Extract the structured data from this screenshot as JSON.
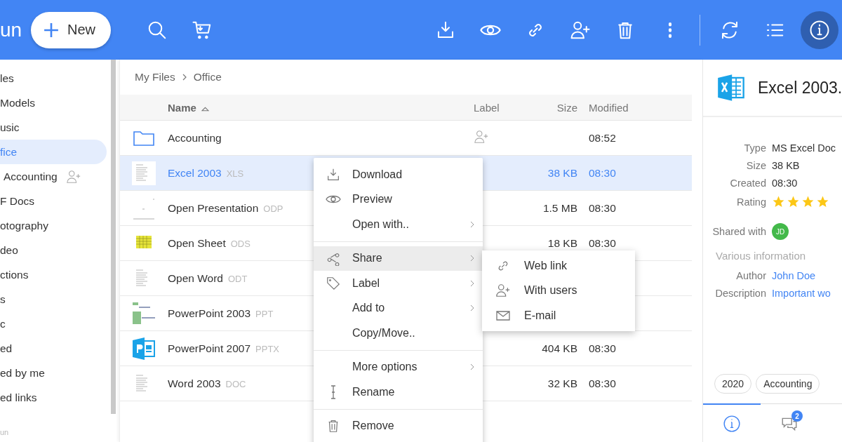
{
  "header": {
    "logo_text": "un",
    "new_button": "New",
    "toolbar_left": [
      {
        "kind": "download",
        "selected": false
      },
      {
        "kind": "preview",
        "selected": false
      },
      {
        "kind": "link",
        "selected": false
      },
      {
        "kind": "share-user",
        "selected": false
      },
      {
        "kind": "trash",
        "selected": false
      },
      {
        "kind": "more",
        "selected": false
      }
    ],
    "toolbar_right": [
      {
        "kind": "refresh",
        "selected": false
      },
      {
        "kind": "list",
        "selected": false
      },
      {
        "kind": "info",
        "selected": true
      }
    ]
  },
  "sidebar": {
    "items": [
      {
        "label": "les",
        "selected": false,
        "shared": false
      },
      {
        "label": "Models",
        "selected": false,
        "shared": false
      },
      {
        "label": "usic",
        "selected": false,
        "shared": false
      },
      {
        "label": "fice",
        "selected": true,
        "shared": false,
        "children": [
          {
            "label": "Accounting",
            "selected": false,
            "shared": true
          }
        ]
      },
      {
        "label": "F Docs",
        "selected": false,
        "shared": false
      },
      {
        "label": "otography",
        "selected": false,
        "shared": false
      },
      {
        "label": "deo",
        "selected": false,
        "shared": false
      },
      {
        "label": "ctions",
        "selected": false,
        "shared": false
      },
      {
        "label": "s",
        "selected": false,
        "shared": false
      },
      {
        "label": "c",
        "selected": false,
        "shared": false
      },
      {
        "label": "ed",
        "selected": false,
        "shared": false
      },
      {
        "label": "ed by me",
        "selected": false,
        "shared": false
      },
      {
        "label": "ed links",
        "selected": false,
        "shared": false
      }
    ],
    "footer": "un"
  },
  "breadcrumb": [
    "My Files",
    "Office"
  ],
  "table": {
    "columns": [
      {
        "label": "Name",
        "sorted": true
      },
      {
        "label": "Label",
        "sorted": false
      },
      {
        "label": "Size",
        "sorted": false
      },
      {
        "label": "Modified",
        "sorted": false
      }
    ],
    "rows": [
      {
        "kind": "folder",
        "name": "Accounting",
        "shared": true,
        "modified": "08:52",
        "selected": false
      },
      {
        "kind": "sheet-doc",
        "name": "Excel 2003",
        "ext": "XLS",
        "size": "38 KB",
        "modified": "08:30",
        "selected": true
      },
      {
        "kind": "slide-doc",
        "name": "Open Presentation",
        "ext": "ODP",
        "size": "1.5 MB",
        "modified": "08:30",
        "selected": false
      },
      {
        "kind": "yellow-sheet",
        "name": "Open Sheet",
        "ext": "ODS",
        "size": "18 KB",
        "modified": "08:30",
        "selected": false
      },
      {
        "kind": "text-doc",
        "name": "Open Word",
        "ext": "ODT",
        "selected": false
      },
      {
        "kind": "green-slide",
        "name": "PowerPoint 2003",
        "ext": "PPT",
        "selected": false
      },
      {
        "kind": "pptx",
        "name": "PowerPoint 2007",
        "ext": "PPTX",
        "size": "404 KB",
        "modified": "08:30",
        "selected": false
      },
      {
        "kind": "text-doc",
        "name": "Word 2003",
        "ext": "DOC",
        "size": "32 KB",
        "modified": "08:30",
        "selected": false
      }
    ]
  },
  "context_menu": {
    "groups": [
      [
        {
          "kind": "download",
          "label": "Download",
          "submenu": false,
          "selected": false
        },
        {
          "kind": "preview",
          "label": "Preview",
          "submenu": false,
          "selected": false
        },
        {
          "kind": "plain",
          "label": "Open with..",
          "submenu": true,
          "selected": false
        }
      ],
      [
        {
          "kind": "share",
          "label": "Share",
          "submenu": true,
          "selected": true
        },
        {
          "kind": "tag",
          "label": "Label",
          "submenu": true,
          "selected": false
        },
        {
          "kind": "plain",
          "label": "Add to",
          "submenu": true,
          "selected": false
        },
        {
          "kind": "plain",
          "label": "Copy/Move..",
          "submenu": false,
          "selected": false
        }
      ],
      [
        {
          "kind": "plain",
          "label": "More options",
          "submenu": true,
          "selected": false
        },
        {
          "kind": "cursor",
          "label": "Rename",
          "submenu": false,
          "selected": false
        }
      ],
      [
        {
          "kind": "trash",
          "label": "Remove",
          "submenu": false,
          "selected": false
        }
      ]
    ],
    "submenu": [
      {
        "kind": "link",
        "label": "Web link"
      },
      {
        "kind": "share-user",
        "label": "With users"
      },
      {
        "kind": "mail",
        "label": "E-mail"
      }
    ]
  },
  "details": {
    "title": "Excel 2003.",
    "properties": [
      {
        "label": "Type",
        "value": "MS Excel Doc"
      },
      {
        "label": "Size",
        "value": "38 KB"
      },
      {
        "label": "Created",
        "value": "08:30"
      }
    ],
    "rating_label": "Rating",
    "stars": 4,
    "shared_label": "Shared with",
    "shared_users": [
      {
        "initials": "JD",
        "color": "#43b94a"
      }
    ],
    "section": "Various information",
    "info": [
      {
        "label": "Author",
        "value": "John Doe"
      },
      {
        "label": "Description",
        "value": "Important wo"
      }
    ],
    "tags": [
      "2020",
      "Accounting"
    ],
    "tabs": [
      {
        "kind": "info",
        "selected": true
      },
      {
        "kind": "comments",
        "selected": false,
        "badge": "2"
      }
    ]
  }
}
